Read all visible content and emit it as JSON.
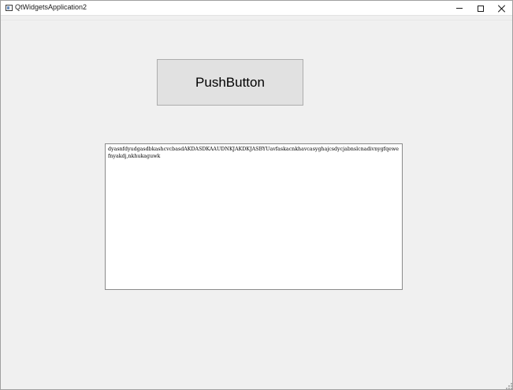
{
  "window": {
    "title": "QtWidgetsApplication2",
    "controls": {
      "minimize": "minimize",
      "maximize": "maximize",
      "close": "close"
    }
  },
  "main": {
    "push_button_label": "PushButton",
    "text_edit_content": "dyasnfdyudgasdbkashcvcbasdAKDASDKAAUDNKJAKDKJASBYUavfaskacnkhavcasyghajcsdycjabnslcnadivnygfqewefnyakdj,nkhukaguwk"
  },
  "icons": {
    "app": "app-window-icon",
    "minimize": "minimize-icon",
    "maximize": "maximize-icon",
    "close": "close-icon",
    "grip": "size-grip-icon"
  }
}
